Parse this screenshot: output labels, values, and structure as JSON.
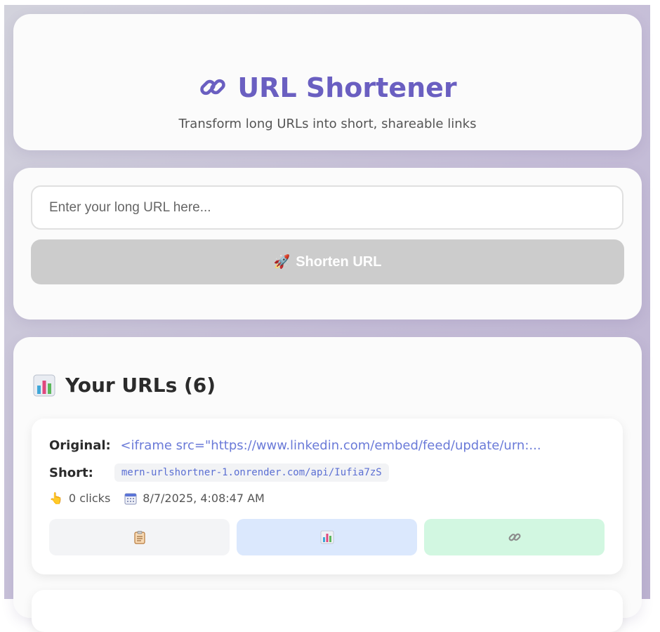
{
  "header": {
    "title": "URL Shortener",
    "subtitle": "Transform long URLs into short, shareable links"
  },
  "form": {
    "placeholder": "Enter your long URL here...",
    "value": "",
    "button_label": "Shorten URL",
    "button_icon": "rocket-icon"
  },
  "urls_section": {
    "heading": "Your URLs (6)",
    "icon": "bar-chart-icon",
    "items": [
      {
        "original_label": "Original:",
        "original": "<iframe src=\"https://www.linkedin.com/embed/feed/update/urn:...",
        "short_label": "Short:",
        "short": "mern-urlshortner-1.onrender.com/api/Iufia7zS",
        "clicks": "0 clicks",
        "date": "8/7/2025, 4:08:47 AM",
        "actions": [
          "clipboard-icon",
          "bar-chart-icon",
          "link-icon"
        ]
      }
    ]
  },
  "colors": {
    "accent": "#6a5fc1",
    "link": "#6a7ad8",
    "disabled_button": "#cccccc",
    "copy_bg": "#f3f4f6",
    "stats_bg": "#dbe8fd",
    "open_bg": "#d2f7e1"
  }
}
